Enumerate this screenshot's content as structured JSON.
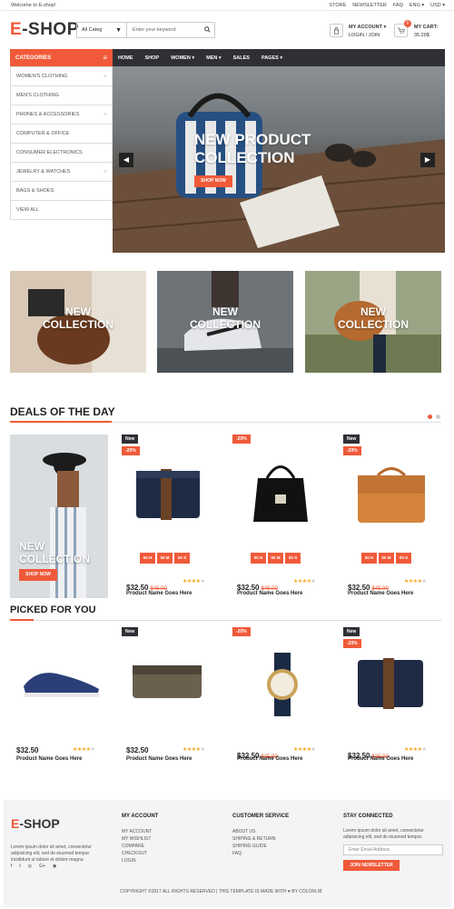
{
  "topbar": {
    "welcome": "Welcome to E-shop!",
    "links": [
      "STORE",
      "NEWSLETTER",
      "FAQ",
      "ENG ▾",
      "USD ▾"
    ]
  },
  "header": {
    "logo_e": "E",
    "logo_rest": "-SHOP",
    "search_category": "All Categ",
    "search_placeholder": "Enter your keyword",
    "account_title": "MY ACCOUNT ▾",
    "account_sub": "LOGIN / JOIN",
    "cart_title": "MY CART:",
    "cart_total": "35.20$",
    "cart_count": "0"
  },
  "nav": {
    "categories_label": "CATEGORIES",
    "items": [
      "HOME",
      "SHOP",
      "WOMEN ▾",
      "MEN ▾",
      "SALES",
      "PAGES ▾"
    ]
  },
  "categories": [
    {
      "label": "WOMEN'S CLOTHING",
      "arrow": "›"
    },
    {
      "label": "MEN'S CLOTHING",
      "arrow": ""
    },
    {
      "label": "PHONES & ACCESSORIES",
      "arrow": "›"
    },
    {
      "label": "COMPUTER & OFFICE",
      "arrow": ""
    },
    {
      "label": "CONSUMER ELECTRONICS",
      "arrow": ""
    },
    {
      "label": "JEWELRY & WATCHES",
      "arrow": "›"
    },
    {
      "label": "BAGS & SHOES",
      "arrow": ""
    },
    {
      "label": "VIEW ALL",
      "arrow": ""
    }
  ],
  "hero": {
    "title_line1": "NEW PRODUCT",
    "title_line2": "COLLECTION",
    "button": "SHOP NOW",
    "prev": "◀",
    "next": "▶"
  },
  "banners": [
    {
      "line1": "NEW",
      "line2": "COLLECTION"
    },
    {
      "line1": "NEW",
      "line2": "COLLECTION"
    },
    {
      "line1": "NEW",
      "line2": "COLLECTION"
    }
  ],
  "deals": {
    "title": "DEALS OF THE DAY",
    "promo_line1": "NEW",
    "promo_line2": "COLLECTION",
    "promo_button": "SHOP NOW",
    "timer": [
      "00 H",
      "00 M",
      "00 S"
    ],
    "products": [
      {
        "tag1": "New",
        "tag2": "-20%",
        "price": "$32.50",
        "old": "$45.00",
        "rating": 4,
        "name": "Product Name Goes Here"
      },
      {
        "tag1": "",
        "tag2": "-20%",
        "price": "$32.50",
        "old": "$45.00",
        "rating": 4,
        "name": "Product Name Goes Here"
      },
      {
        "tag1": "New",
        "tag2": "-20%",
        "price": "$32.50",
        "old": "$45.00",
        "rating": 4,
        "name": "Product Name Goes Here"
      }
    ]
  },
  "picked": {
    "title": "PICKED FOR YOU",
    "products": [
      {
        "tag1": "",
        "tag2": "",
        "price": "$32.50",
        "old": "",
        "rating": 4,
        "name": "Product Name Goes Here"
      },
      {
        "tag1": "New",
        "tag2": "",
        "price": "$32.50",
        "old": "",
        "rating": 4,
        "name": "Product Name Goes Here"
      },
      {
        "tag1": "",
        "tag2": "-20%",
        "price": "$32.50",
        "old": "$45.00",
        "rating": 4,
        "name": "Product Name Goes Here"
      },
      {
        "tag1": "New",
        "tag2": "-20%",
        "price": "$32.50",
        "old": "$45.00",
        "rating": 4,
        "name": "Product Name Goes Here"
      }
    ]
  },
  "footer": {
    "logo_e": "E",
    "logo_rest": "-SHOP",
    "about": "Lorem ipsum dolor sit amet, consectetur adipisicing elit, sed do eiusmod tempor incididunt ut labore et dolore magna",
    "social": [
      "f",
      "t",
      "◎",
      "G+",
      "◉"
    ],
    "account_head": "MY ACCOUNT",
    "account_links": [
      "MY ACCOUNT",
      "MY WISHLIST",
      "COMPARE",
      "CHECKOUT",
      "LOGIN"
    ],
    "service_head": "CUSTOMER SERVICE",
    "service_links": [
      "ABOUT US",
      "SHIPING & RETURN",
      "SHIPING GUIDE",
      "FAQ"
    ],
    "newsletter_head": "STAY CONNECTED",
    "newsletter_text": "Lorem ipsum dolor sit amet, consectetur adipisicing elit, sed do eiusmod tempor.",
    "email_placeholder": "Enter Email Address",
    "join_button": "JOIN NEWSLETTER",
    "copyright": "COPYRIGHT ©2017 ALL RIGHTS RESERVED | THIS TEMPLATE IS MADE WITH ♥ BY COLORLIB"
  },
  "colors": {
    "accent": "#f05a3a",
    "dark": "#2f2f35"
  }
}
